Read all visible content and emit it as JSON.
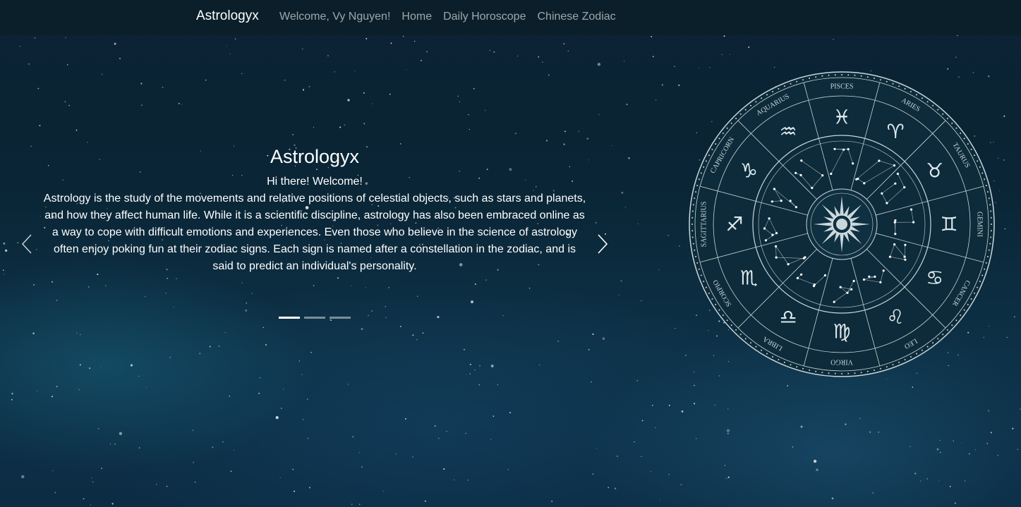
{
  "navbar": {
    "brand": "Astrologyx",
    "welcome": "Welcome, Vy Nguyen!",
    "links": [
      "Home",
      "Daily Horoscope",
      "Chinese Zodiac"
    ]
  },
  "carousel": {
    "title": "Astrologyx",
    "greeting": "Hi there! Welcome!",
    "description": "Astrology is the study of the movements and relative positions of celestial objects, such as stars and planets, and how they affect human life. While it is a scientific discipline, astrology has also been embraced online as a way to cope with difficult emotions and experiences. Even those who believe in the science of astrology often enjoy poking fun at their zodiac signs. Each sign is named after a constellation in the zodiac, and is said to predict an individual's personality.",
    "slide_count": 3,
    "active_slide": 1,
    "prev_icon": "chevron-left-icon",
    "next_icon": "chevron-right-icon"
  },
  "zodiac_wheel": {
    "signs": [
      {
        "name": "PISCES",
        "glyph": "♓"
      },
      {
        "name": "ARIES",
        "glyph": "♈"
      },
      {
        "name": "TAURUS",
        "glyph": "♉"
      },
      {
        "name": "GEMINI",
        "glyph": "♊"
      },
      {
        "name": "CANCER",
        "glyph": "♋"
      },
      {
        "name": "LEO",
        "glyph": "♌"
      },
      {
        "name": "VIRGO",
        "glyph": "♍"
      },
      {
        "name": "LIBRA",
        "glyph": "♎"
      },
      {
        "name": "SCORPIO",
        "glyph": "♏"
      },
      {
        "name": "SAGITTARIUS",
        "glyph": "♐"
      },
      {
        "name": "CAPRICORN",
        "glyph": "♑"
      },
      {
        "name": "AQUARIUS",
        "glyph": "♒"
      }
    ],
    "center_icon": "sun-icon"
  },
  "colors": {
    "navbar_bg": "#0a1e28",
    "wheel_line": "#c9d6dc",
    "text": "#ffffff"
  }
}
